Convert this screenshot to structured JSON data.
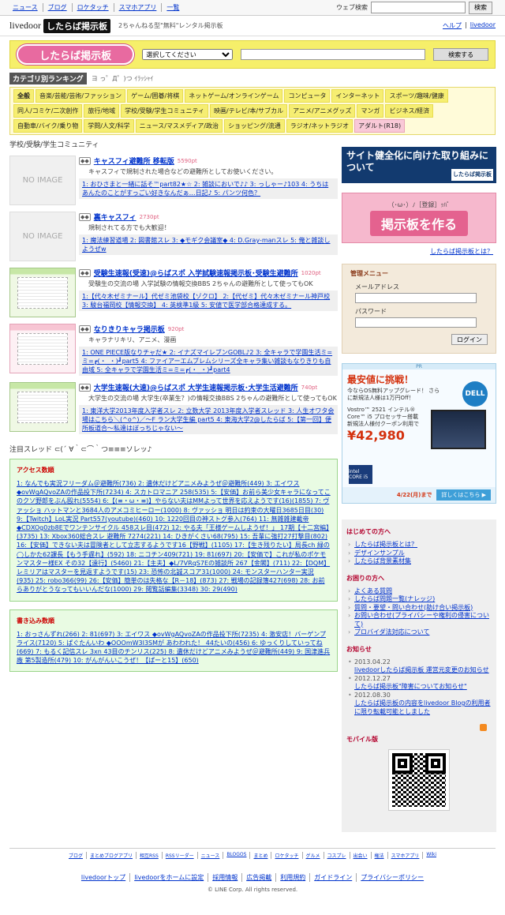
{
  "topnav": {
    "links": [
      "ニュース",
      "ブログ",
      "ロケタッチ",
      "スマホアプリ",
      "一覧"
    ],
    "search_label": "ウェブ検索",
    "search_button": "検索"
  },
  "logobar": {
    "livedoor": "livedoor",
    "brand": "したらば掲示板",
    "tagline": "2ちゃんねる型\"無料\"レンタル掲示板",
    "help": "ヘルプ",
    "livedoor_link": "livedoor"
  },
  "banner": {
    "logo_text": "したらば掲示板",
    "select_value": "選択してください",
    "search_button": "検索する"
  },
  "ranking": {
    "title": "カテゴリ別ランキング",
    "face": "ヨ っ゜Д゜)つ ｲﾗｯｼｬｲ"
  },
  "categories": [
    {
      "label": "全般",
      "sel": true
    },
    {
      "label": "音楽/芸能/芸術/ファッション"
    },
    {
      "label": "ゲーム/囲碁/将棋"
    },
    {
      "label": "ネットゲーム/オンラインゲーム"
    },
    {
      "label": "コンピュータ"
    },
    {
      "label": "インターネット"
    },
    {
      "label": "スポーツ/趣味/健康"
    },
    {
      "label": "同人/コミケ/二次創作"
    },
    {
      "label": "旅行/地域"
    },
    {
      "label": "学校/受験/学生コミュニティ"
    },
    {
      "label": "映画/テレビ/本/サブカル"
    },
    {
      "label": "アニメ/アニメグッズ"
    },
    {
      "label": "マンガ"
    },
    {
      "label": "ビジネス/経済"
    },
    {
      "label": "自動車/バイク/乗り物"
    },
    {
      "label": "学問/人文/科学"
    },
    {
      "label": "ニュース/マスメディア/政治"
    },
    {
      "label": "ショッピング/流通"
    },
    {
      "label": "ラジオ/ネットラジオ"
    },
    {
      "label": "アダルト(R18)",
      "adult": true
    }
  ],
  "section_title": "学校/受験/学生コミュニティ",
  "no_image": "NO IMAGE",
  "boards": [
    {
      "name": "キャスフィ避難所 移転版",
      "points": "5590pt",
      "desc": "キャスフィで規制された場合などの避難所としてお使いください。",
      "threads": "1: おひさまと一緒に話そ™part82★☆ 2: 雑談においで♪♪ 3: っしゃー♪103 4: うちはあんたのことがすっごい好きなんだぁ…日記♪ 5: パンツ何色？",
      "thumb": "none"
    },
    {
      "name": "裏キャスフィ",
      "points": "2730pt",
      "desc": "規制されてる方でも大歓迎！",
      "threads": "1: 魔法練習道場 2: 図書館スレ 3: ◆モギク会議室◆ 4: D.Gray-manスレ 5: 俺と雑談しようぜw",
      "thumb": "none"
    },
    {
      "name": "受験生速報(受速)@らばスポ 入学試験速報掲示板･受験生避難所",
      "points": "1020pt",
      "desc": "受験生の交流の場 入学試験の情報交換BBS 2ちゃんの避難所として使ってもOK",
      "threads": "1:【代々木ゼミナール】代ゼミ池袋校【ゾクロ】 2:【代ゼミ】代々木ゼミナール神戸校 3: 駿台福岡校【情報交換】 4: 英検準1級 5: 安値で医学部合格達成する。",
      "thumb": "green"
    },
    {
      "name": "なりきりキャラ掲示板",
      "points": "920pt",
      "desc": "キャラナリキリ、アニメ、漫画",
      "threads": "1: ONE PIECE版なりチャだ★ 2: イナズマイレブンGOBL♪2 3: 全キャラで学園生活ミ=ミ=┏(・_・)┛part5 4: ファイアーエムブレムシリーズ全キャラ集い雑談もなりきりも自由域 5: 全キャラで学園生活ミ=ミ=┏(・_・)┛part4",
      "thumb": "pink"
    },
    {
      "name": "大学生速報(大速)@らばスポ 大学生速報掲示板･大学生活避難所",
      "points": "740pt",
      "desc": "大学生の交流の場 大学生(卒業生？)の情報交換BBS 2ちゃんの避難所として使ってもOK",
      "threads": "1: 東洋大学2013年度入学者スレ 2: 立数大学 2013年度入学者スレッド 3: 人生オワタ会場はこちら＼(^o^)／～F ラン大学生編 part5 4: 東海大学2@したらば 5:【第一回】便所板道合～私達はぼっちじゃない～",
      "thumb": "green"
    }
  ],
  "attention_title": "注目スレッド ⊂(´ ∀｀⊂⌒｀つ≡≡≡ソレッ♪",
  "access": {
    "title": "アクセス数順",
    "text": "1: なんでも実況フリーダム＠避難所(736) 2: 遺休だけどアニメみようぜ＠避難所(449) 3: エイワス◆ovWgAQvoZAの作品投下所(7234) 4: スカトロマニア 258(535) 5:【安価】お前ら美少女キャラになってこのクソ野郎をぶん殴れ(5554) 6:【(≡・ω・≡)】やらない夫はMMよって世界を応えようです(16)(1855) 7: ヴァッショ ハットマンと3684人のアメコミヒーロー(1000) 8: ヴァッショ 明日は約束の大曜日3685日目(30) 9:【Twitch】LoL実況 Part557(youtube)(460) 10: 1220回目の神ストグ参入(764) 11: 無雑雑建載帝◆CDXOg0zb8Eでワンテンサイクル 458スレ目(472) 12: やる夫「王様ゲームしようぜ！」 17期【十二宮編】(3735) 13: Xbox360総合スレ 避難所 7274(221) 14: ひきがくさい68(795) 15: 吾輩に強打27打撃目(802) 16:【安価】できない夫は冒険者として立志するようです16【野戦】(1105) 17:【生き残りたい】局長ch 緑の◯しかた62課長【もう手遅れ】(592) 18: ニコチン409(721) 19: 81(697) 20:【安価で】これが私のポケモンマスター様EX その32【遠行】(5460) 21:【主夫】◆L/7VRqS7Eの雑談所 267【金閣】(711) 22:【DQM】レミリアはマスターを見返すようです(15) 23: 恐怖の北誠スコア31(1000) 24: モンスターハンター実況(935) 25: robo366(99) 26:【安価】簡単のは失格な【R－18】(873) 27: 戦場の記録簿427(698) 28: お前らありがとうなってもいいんだな(1000) 29: 閲覧話編集(3348) 30: 29(490)"
  },
  "writes": {
    "title": "書き込み数順",
    "text": "1: おっさんずれ(266) 2: 81(697) 3: エイワス ◆ovWgAQvoZAの作品投下所(7235) 4: 激安店！バーゲンプライス(7120) 5: ぱぐたんいわ ◆OOOmW3I3SMが あわわれた！ 44たいの(456) 6: ゆっくりしていってね(669) 7: もるく記信スレ 3xn 43目のチンリス(225) 8: 遺休だけどアニメみようぜ＠避難所(449) 9: 国津進兵廠 第5製造所(479) 10: がんがんいこうぜ！【ぱーと15】(650)"
  },
  "sidebar": {
    "banner_text": "サイト健全化に向けた取り組みについて",
    "banner_mini": "したらば掲示板",
    "make_sub": "（･ω･）ﾉ［登録］ｯﾊﾟ",
    "make_button": "掲示板を作る",
    "whatis": "したらば掲示板とは？",
    "admin_title": "管理メニュー",
    "email_label": "メールアドレス",
    "password_label": "パスワード",
    "login_button": "ログイン",
    "ad": {
      "pr": "PR",
      "title": "最安値に挑戦！",
      "sub": "今ならOS無料アップグレード！ さらに新規法人様は1万円Off！",
      "logo": "DELL",
      "model": "Vostro™ 2521 インテル® Core™ i5 プロセッサー搭載 新規法人様付クーポン利用で",
      "price": "¥42,980",
      "chip": "intel CORE i5",
      "date": "4/22(月)まで",
      "more": "詳しくはこちら ▶"
    },
    "beginner_title": "はじめての方へ",
    "beginner": [
      "したらば掲示板とは？",
      "デザインサンプル",
      "したらば背景素材集"
    ],
    "trouble_title": "お困りの方へ",
    "trouble": [
      "よくある質問",
      "したらば問題一覧(ナレッジ)",
      "質問・要望・問い合わせ(助け合い掲示板)",
      "お問い合わせ(プライバシーや権利の侵害について)",
      "プロバイダ法対応について"
    ],
    "news_title": "お知らせ",
    "news": [
      {
        "date": "2013.04.22",
        "text": "livedoorしたらば掲示板 運営元変更のお知らせ"
      },
      {
        "date": "2012.12.27",
        "text": "したらば掲示板\"障害についてお知らせ\""
      },
      {
        "date": "2012.08.30",
        "text": "したらば掲示板の内容をlivedoor Blogの利用者に限り転載可能としました"
      }
    ],
    "mobile_title": "モバイル版"
  },
  "footer": {
    "row1": [
      "ブログ",
      "まとめブログアプリ",
      "相互RSS",
      "RSSリーダー",
      "ニュース",
      "BLOGOS",
      "まとめ",
      "ロケタッチ",
      "グルメ",
      "コスプレ",
      "出会い",
      "権法",
      "スマホアプリ",
      "Wiki"
    ],
    "row2": [
      "livedoorトップ",
      "livedoorをホームに設定",
      "採用情報",
      "広告掲載",
      "利用規約",
      "ガイドライン",
      "プライバシーポリシー"
    ],
    "copyright": "© LINE Corp. All rights reserved."
  }
}
